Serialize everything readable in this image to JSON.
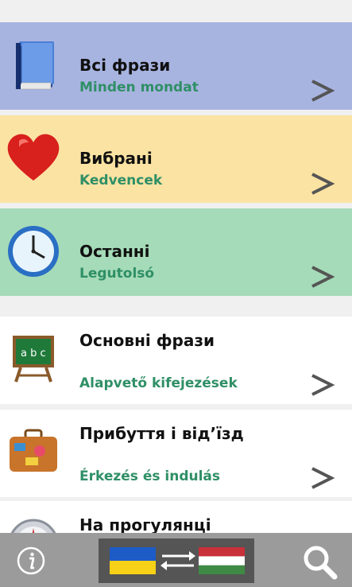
{
  "menu": [
    {
      "title": "Всі фрази",
      "subtitle": "Minden mondat",
      "bg": "#a8b4e0",
      "icon": "book-icon"
    },
    {
      "title": "Вибрані",
      "subtitle": "Kedvencek",
      "bg": "#fbe3a3",
      "icon": "heart-icon"
    },
    {
      "title": "Останні",
      "subtitle": "Legutolsó",
      "bg": "#a5dbb8",
      "icon": "clock-icon"
    }
  ],
  "categories": [
    {
      "title": "Основні фрази",
      "subtitle": "Alapvető kifejezések",
      "bg": "#ffffff",
      "icon": "chalkboard-icon"
    },
    {
      "title": "Прибуття і від’їзд",
      "subtitle": "Érkezés és indulás",
      "bg": "#ffffff",
      "icon": "suitcase-icon"
    },
    {
      "title": "На прогулянці",
      "subtitle": "",
      "bg": "#ffffff",
      "icon": "compass-icon"
    }
  ],
  "toolbar": {
    "info_icon": "info-icon",
    "language_switch": {
      "from_flag": "ukraine-flag-icon",
      "to_flag": "hungary-flag-icon",
      "swap_icon": "swap-arrows-icon"
    },
    "search_icon": "search-icon"
  },
  "colors": {
    "subtitle": "#2f8f66",
    "chevron": "#555555",
    "toolbar": "#9b9b9b"
  }
}
